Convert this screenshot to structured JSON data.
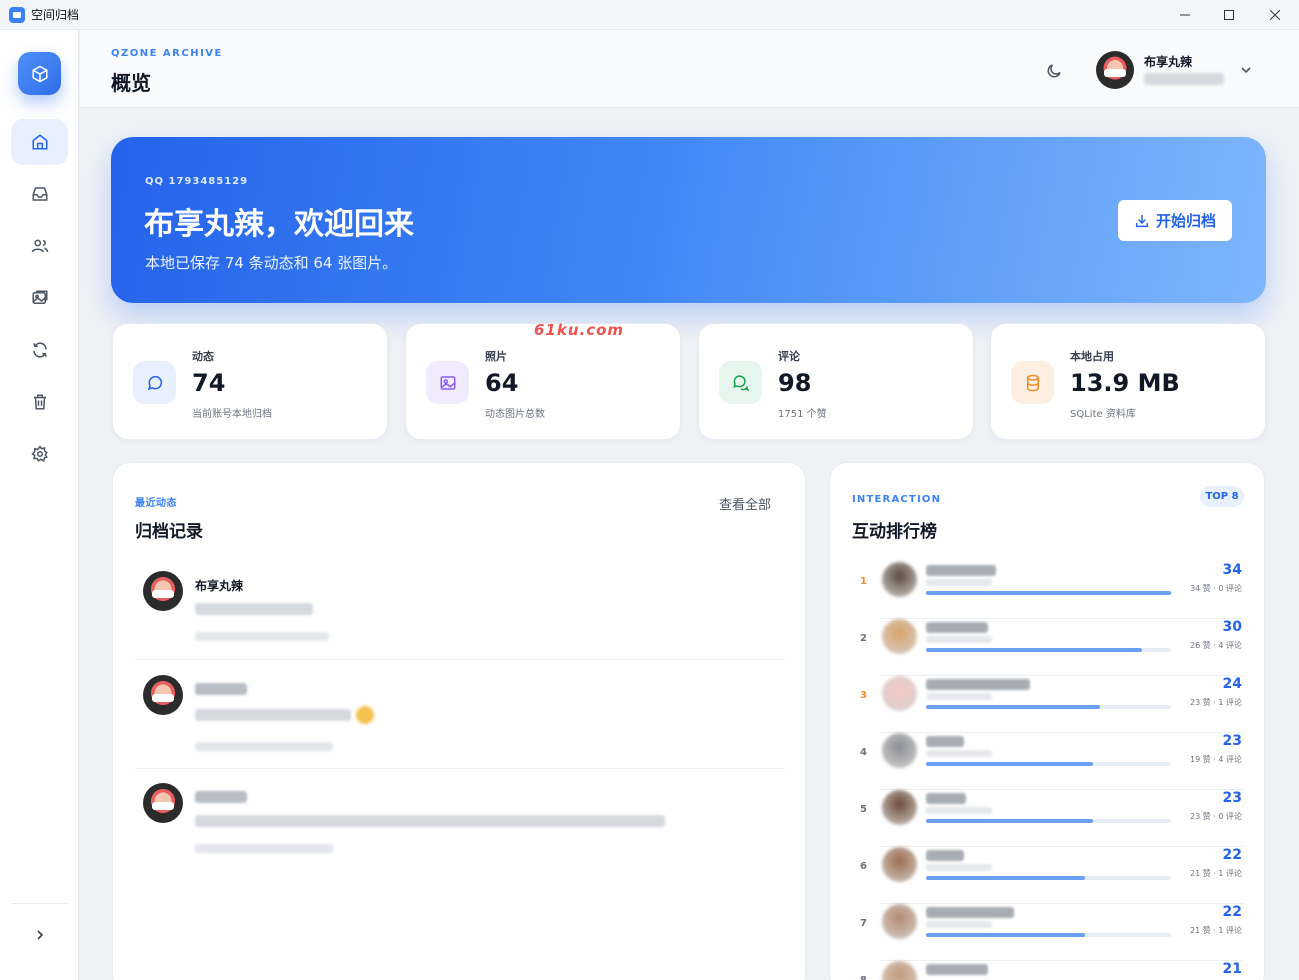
{
  "window": {
    "title": "空间归档"
  },
  "header": {
    "kicker": "QZONE ARCHIVE",
    "title": "概览",
    "user_name": "布享丸辣"
  },
  "hero": {
    "qq": "QQ 1793485129",
    "welcome": "布享丸辣，欢迎回来",
    "summary": "本地已保存 74 条动态和 64 张图片。",
    "archive_button": "开始归档"
  },
  "watermark": "61ku.com",
  "stats": [
    {
      "label": "动态",
      "value": "74",
      "sub": "当前账号本地归档",
      "icon": "message-circle-icon",
      "bg": "#e8f0fe",
      "fg": "#2563eb"
    },
    {
      "label": "照片",
      "value": "64",
      "sub": "动态图片总数",
      "icon": "image-icon",
      "bg": "#f1ecfd",
      "fg": "#8b5cf6"
    },
    {
      "label": "评论",
      "value": "98",
      "sub": "1751 个赞",
      "icon": "chat-bubbles-icon",
      "bg": "#e6f6ee",
      "fg": "#16a34a"
    },
    {
      "label": "本地占用",
      "value": "13.9 MB",
      "sub": "SQLite 资料库",
      "icon": "database-icon",
      "bg": "#fdf0e2",
      "fg": "#f08a24"
    }
  ],
  "records": {
    "kicker": "最近动态",
    "title": "归档记录",
    "view_all": "查看全部",
    "items": [
      {
        "name": "布享丸辣"
      }
    ]
  },
  "ranking": {
    "kicker": "INTERACTION",
    "title": "互动排行榜",
    "badge": "TOP 8",
    "items": [
      {
        "rank": "1",
        "score": "34",
        "detail": "34 赞 · 0 评论",
        "ratio": 1.0
      },
      {
        "rank": "2",
        "score": "30",
        "detail": "26 赞 · 4 评论",
        "ratio": 0.88
      },
      {
        "rank": "3",
        "score": "24",
        "detail": "23 赞 · 1 评论",
        "ratio": 0.71
      },
      {
        "rank": "4",
        "score": "23",
        "detail": "19 赞 · 4 评论",
        "ratio": 0.68
      },
      {
        "rank": "5",
        "score": "23",
        "detail": "23 赞 · 0 评论",
        "ratio": 0.68
      },
      {
        "rank": "6",
        "score": "22",
        "detail": "21 赞 · 1 评论",
        "ratio": 0.65
      },
      {
        "rank": "7",
        "score": "22",
        "detail": "21 赞 · 1 评论",
        "ratio": 0.65
      },
      {
        "rank": "8",
        "score": "21",
        "detail": "",
        "ratio": 0.62
      }
    ]
  },
  "colors": {
    "accent": "#2563eb",
    "rank1": "#f08a24",
    "rank3": "#f08a24"
  }
}
